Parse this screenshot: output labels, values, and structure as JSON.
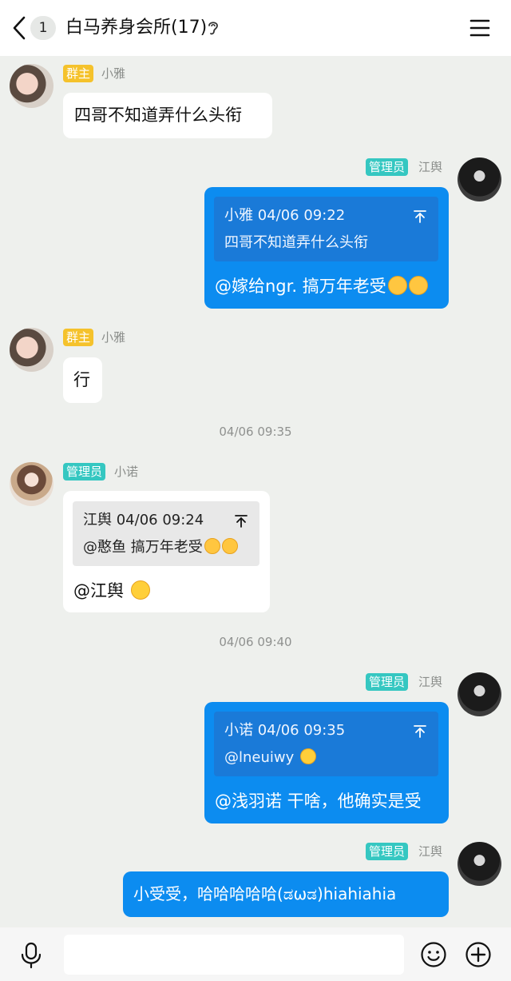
{
  "header": {
    "unread_count": "1",
    "title": "白马养身会所(17)"
  },
  "messages": [
    {
      "role": "群主",
      "sender": "小雅",
      "text": "四哥不知道弄什么头衔"
    },
    {
      "role": "管理员",
      "sender": "江舆",
      "quote_header": "小雅 04/06 09:22",
      "quote_text": "四哥不知道弄什么头衔",
      "text": "@嫁给ngr. 搞万年老受"
    },
    {
      "role": "群主",
      "sender": "小雅",
      "text": "行"
    },
    {
      "role": "管理员",
      "sender": "小诺",
      "quote_header": "江舆 04/06 09:24",
      "quote_text": "@憨鱼 搞万年老受",
      "text": "@江舆"
    },
    {
      "role": "管理员",
      "sender": "江舆",
      "quote_header": "小诺 04/06 09:35",
      "quote_text": "@lneuiwy",
      "text": "@浅羽诺 干啥，他确实是受"
    },
    {
      "role": "管理员",
      "sender": "江舆",
      "text": "小受受，哈哈哈哈哈(ಡωಡ)hiahiahia"
    }
  ],
  "timestamps": [
    "04/06 09:35",
    "04/06 09:40"
  ],
  "icons": {
    "back": "chevron-left-icon",
    "ear": "ear-icon",
    "menu": "menu-icon",
    "quote_arrow": "collapse-arrow-icon",
    "voice": "microphone-icon",
    "emoji": "smiley-icon",
    "plus": "plus-icon"
  },
  "colors": {
    "background": "#eef0ed",
    "own_bubble": "#0c8cf0",
    "owner_badge": "#f5c22c",
    "admin_badge": "#35c7c1"
  }
}
